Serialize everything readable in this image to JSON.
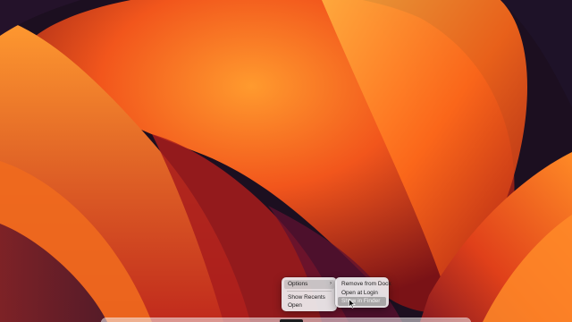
{
  "context_menu": {
    "items": [
      {
        "label": "Options",
        "has_submenu": true
      },
      {
        "label": "Show Recents"
      },
      {
        "label": "Open"
      }
    ]
  },
  "options_submenu": {
    "items": [
      {
        "label": "Remove from Dock"
      },
      {
        "label": "Open at Login"
      },
      {
        "label": "Show in Finder"
      }
    ]
  },
  "icons": {
    "submenu_indicator": "chevron-right-icon",
    "pointer": "arrow-cursor-icon"
  },
  "colors": {
    "wallpaper_dark": "#1a0d18",
    "wallpaper_orange": "#ff7a1a",
    "wallpaper_red": "#d8321a",
    "menu_background": "#eceaec"
  }
}
